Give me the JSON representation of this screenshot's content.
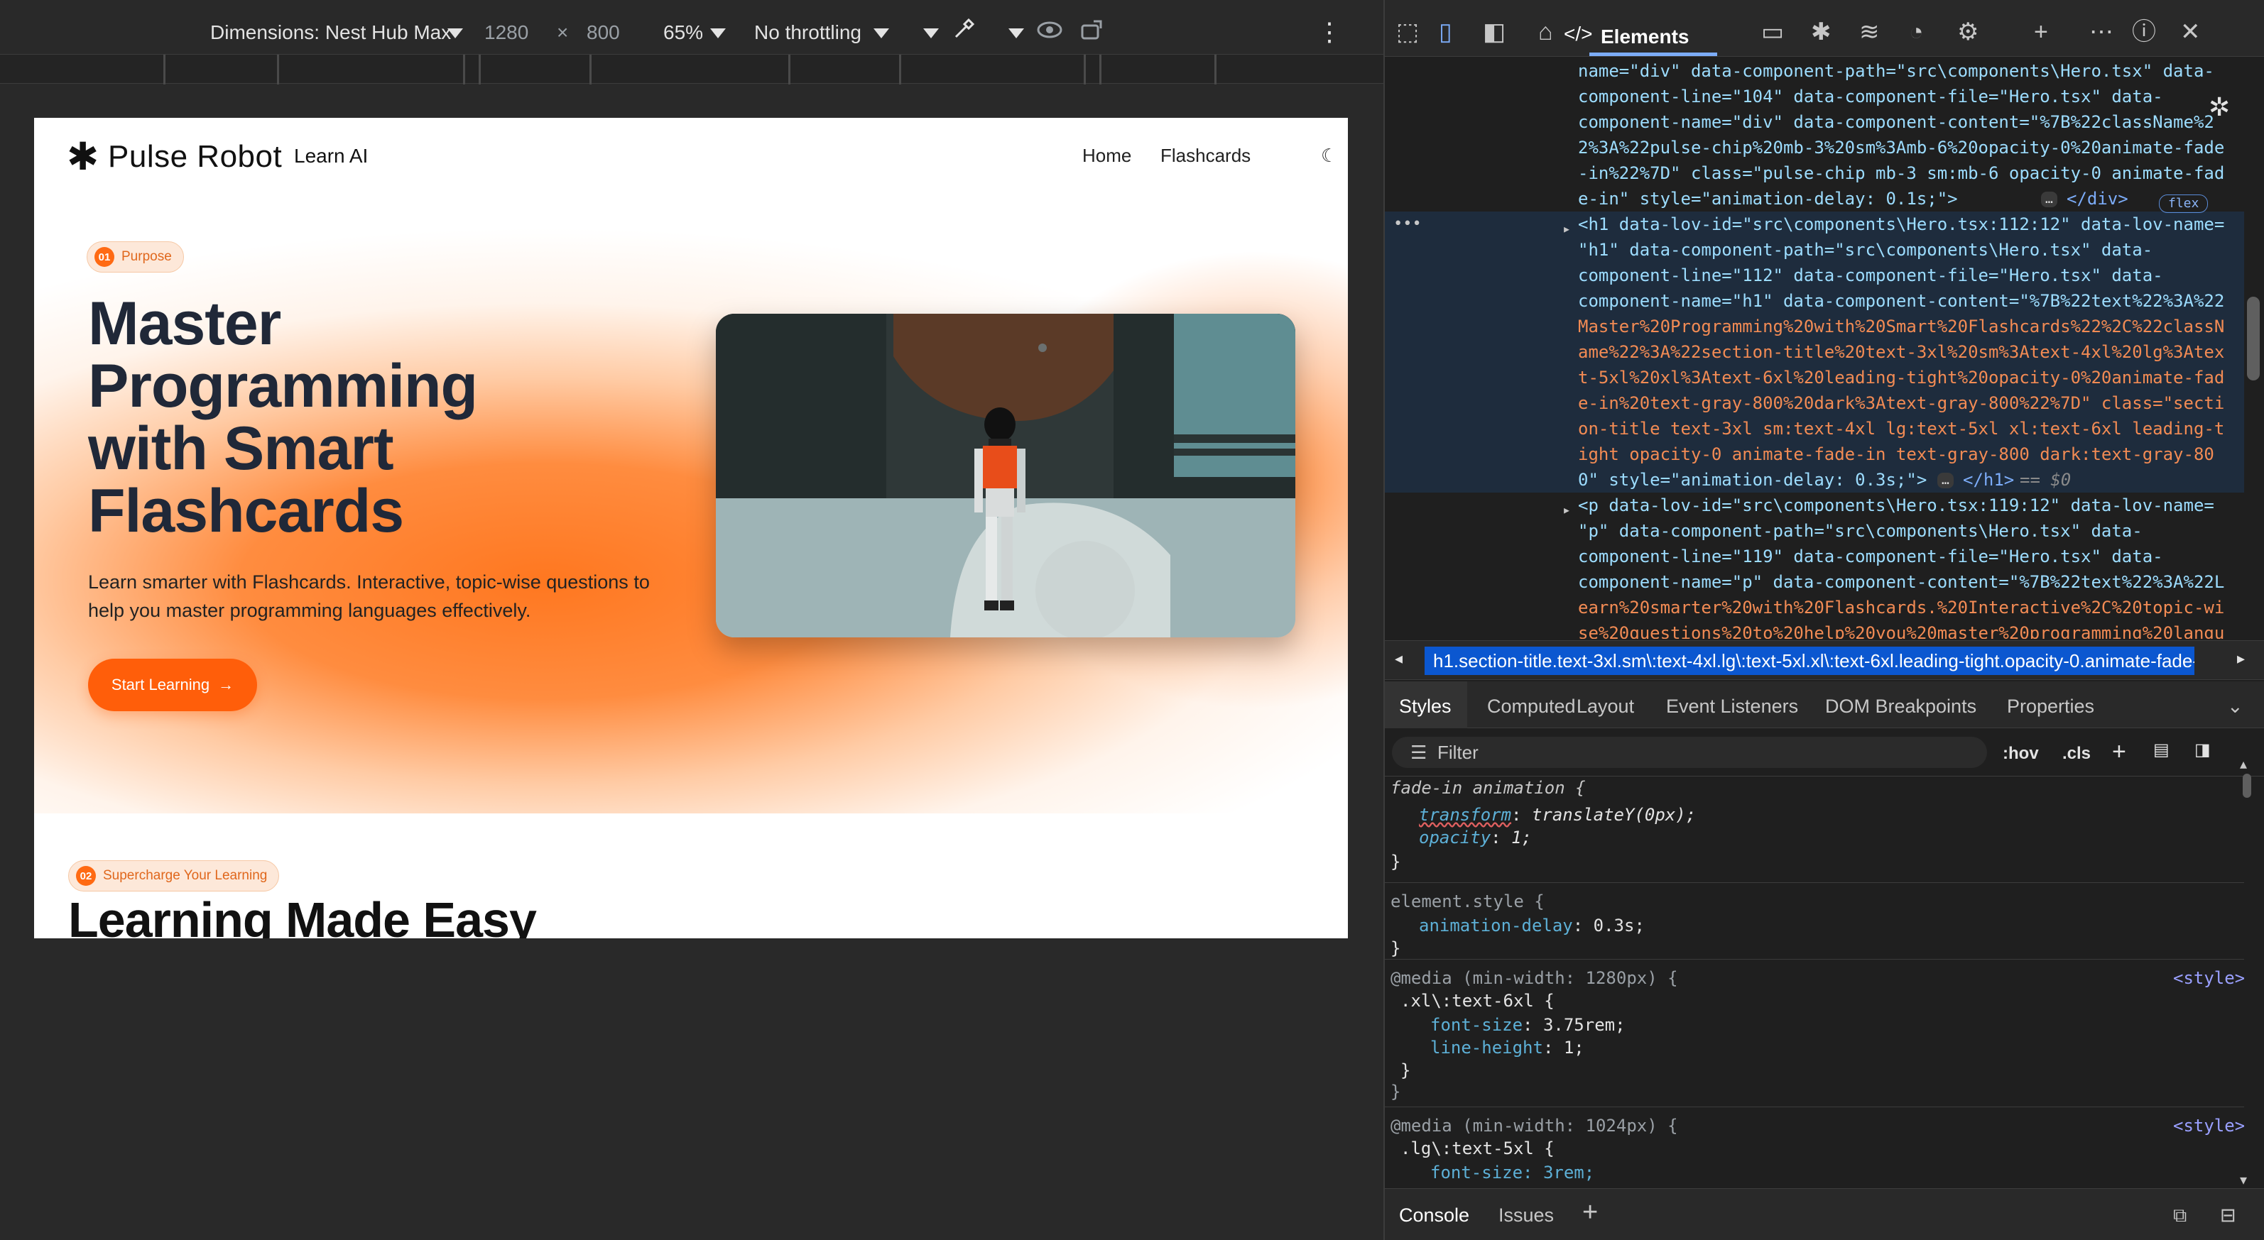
{
  "device_toolbar": {
    "dimensions_label": "Dimensions: Nest Hub Max",
    "width": "1280",
    "times": "×",
    "height": "800",
    "zoom": "65%",
    "throttling": "No throttling",
    "more_icon": "⋮"
  },
  "site": {
    "brand": "Pulse Robot",
    "brand_sub": "Learn AI",
    "nav": [
      "Home",
      "Flashcards"
    ],
    "theme_icon": "moon-icon",
    "chip1": {
      "num": "01",
      "label": "Purpose"
    },
    "hero_title": "Master Programming with Smart Flashcards",
    "hero_paragraph": "Learn smarter with Flashcards. Interactive, topic-wise questions to help you master programming languages effectively.",
    "cta_label": "Start Learning",
    "chip2": {
      "num": "02",
      "label": "Supercharge Your Learning"
    },
    "section2_title": "Learning Made Easy",
    "accent_color": "#ff5e0a"
  },
  "devtools": {
    "active_tab": "Elements",
    "dom_lines": [
      "name=\"div\" data-component-path=\"src\\components\\Hero.tsx\" data-",
      "component-line=\"104\" data-component-file=\"Hero.tsx\" data-",
      "component-name=\"div\" data-component-content=\"%7B%22className%2",
      "2%3A%22pulse-chip%20mb-3%20sm%3Amb-6%20opacity-0%20animate-fade",
      "-in%22%7D\" class=\"pulse-chip mb-3 sm:mb-6 opacity-0 animate-fad",
      "e-in\" style=\"animation-delay: 0.1s;\">",
      "<h1 data-lov-id=\"src\\components\\Hero.tsx:112:12\" data-lov-name=",
      "\"h1\" data-component-path=\"src\\components\\Hero.tsx\" data-",
      "component-line=\"112\" data-component-file=\"Hero.tsx\" data-",
      "component-name=\"h1\" data-component-content=\"%7B%22text%22%3A%22",
      "Master%20Programming%20with%20Smart%20Flashcards%22%2C%22classN",
      "ame%22%3A%22section-title%20text-3xl%20sm%3Atext-4xl%20lg%3Atex",
      "t-5xl%20xl%3Atext-6xl%20leading-tight%20opacity-0%20animate-fad",
      "e-in%20text-gray-800%20dark%3Atext-gray-800%22%7D\" class=\"secti",
      "on-title text-3xl sm:text-4xl lg:text-5xl xl:text-6xl leading-t",
      "ight opacity-0 animate-fade-in text-gray-800 dark:text-gray-80",
      "0\" style=\"animation-delay: 0.3s;\">",
      "<p data-lov-id=\"src\\components\\Hero.tsx:119:12\" data-lov-name=",
      "\"p\" data-component-path=\"src\\components\\Hero.tsx\" data-",
      "component-line=\"119\" data-component-file=\"Hero.tsx\" data-",
      "component-name=\"p\" data-component-content=\"%7B%22text%22%3A%22L",
      "earn%20smarter%20with%20Flashcards.%20Interactive%2C%20topic-wi",
      "se%20questions%20to%20help%20you%20master%20programming%20langu"
    ],
    "end_div": "</div>",
    "end_h1": "</h1>",
    "flex_badge": "flex",
    "selected_hint": "== $0",
    "ellipsis": "…",
    "breadcrumb": "h1.section-title.text-3xl.sm\\:text-4xl.lg\\:text-5xl.xl\\:text-6xl.leading-tight.opacity-0.animate-fade-",
    "styles_tabs": [
      "Styles",
      "Computed",
      "Layout",
      "Event Listeners",
      "DOM Breakpoints",
      "Properties"
    ],
    "filter_placeholder": "Filter",
    "hov": ":hov",
    "cls": ".cls",
    "styles": {
      "fade_in_header": "fade-in animation {",
      "fade_in_props": [
        {
          "name": "transform",
          "value": "translateY(0px);"
        },
        {
          "name": "opacity",
          "value": "1;"
        }
      ],
      "element_style_header": "element.style {",
      "element_style_prop": {
        "name": "animation-delay",
        "value": "0.3s;"
      },
      "media1": "@media (min-width: 1280px) {",
      "media1_selector": ".xl\\:text-6xl {",
      "media1_props": [
        {
          "name": "font-size",
          "value": "3.75rem;"
        },
        {
          "name": "line-height",
          "value": "1;"
        }
      ],
      "media2": "@media (min-width: 1024px) {",
      "media2_selector": ".lg\\:text-5xl {",
      "media2_partial": "font-size: 3rem;",
      "source_link": "<style>"
    },
    "drawer_tabs": [
      "Console",
      "Issues"
    ]
  }
}
